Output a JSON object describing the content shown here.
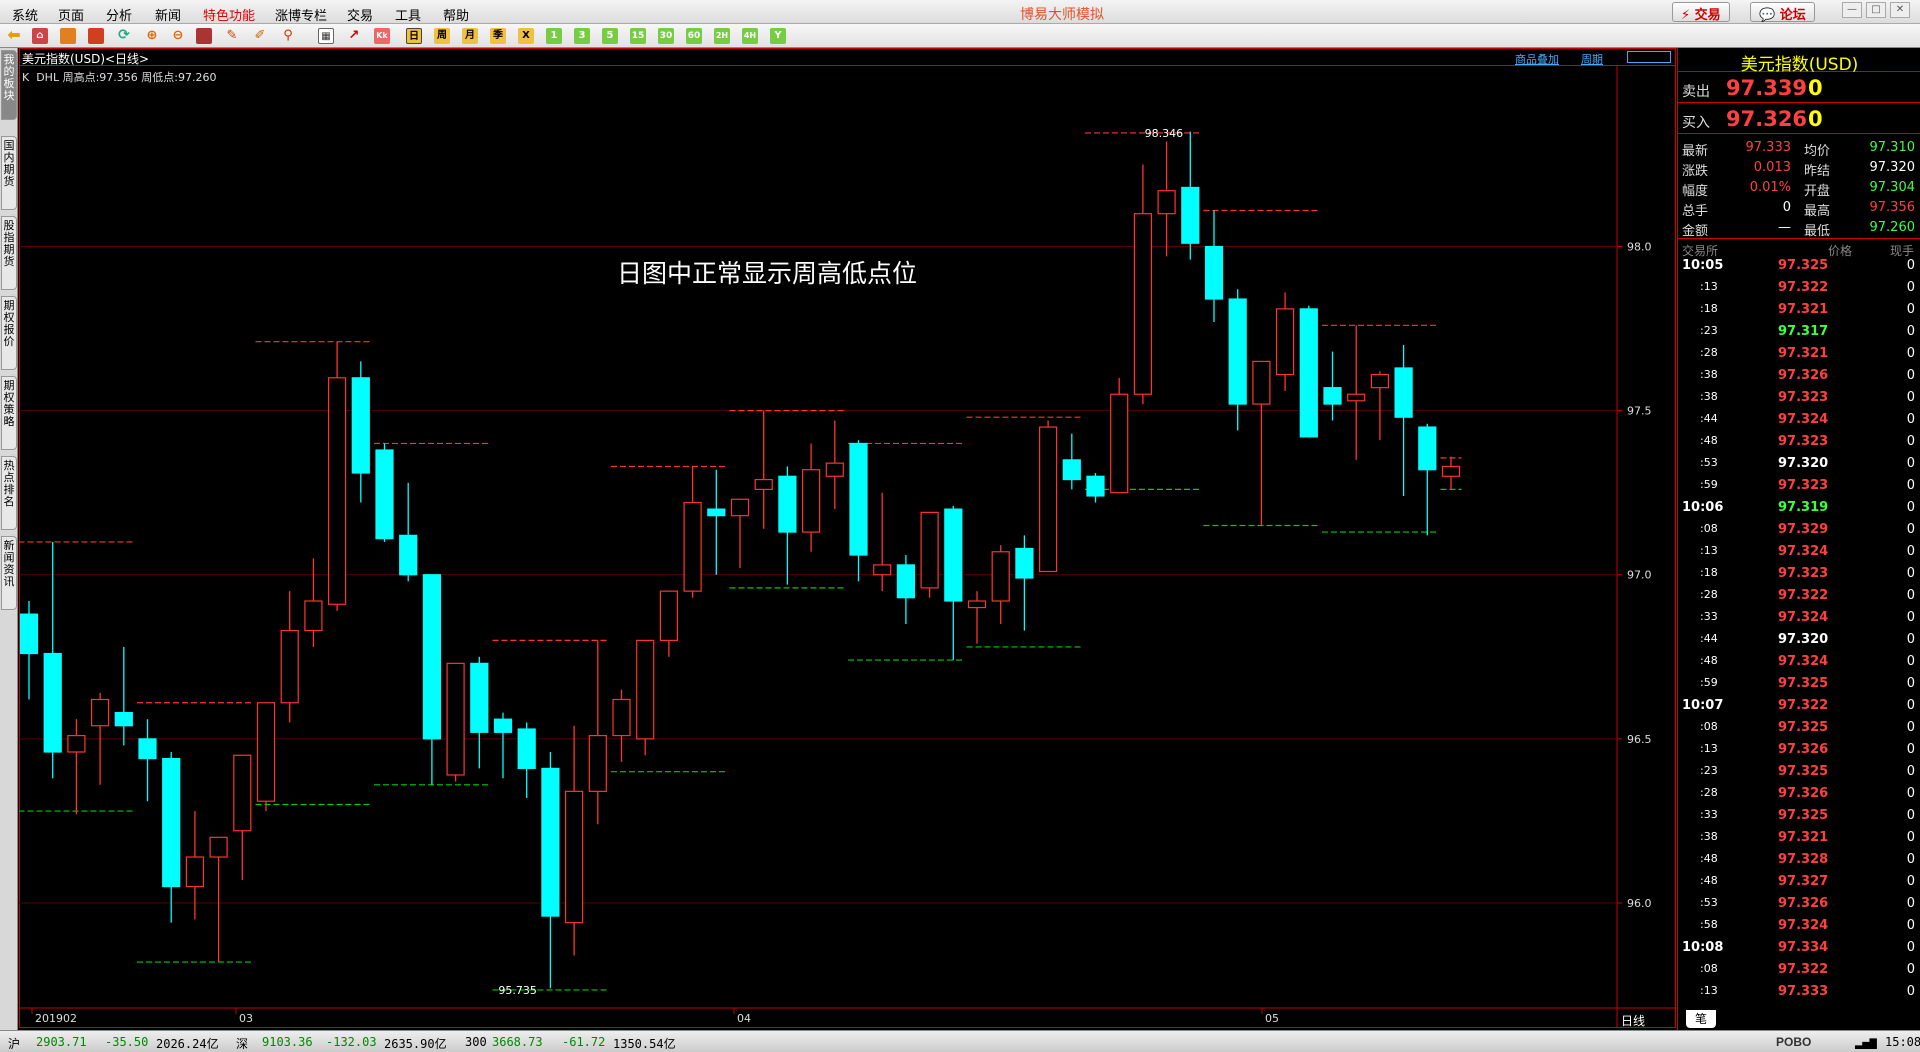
{
  "menu": {
    "items": [
      "系统",
      "页面",
      "分析",
      "新闻",
      "特色功能",
      "涨博专栏",
      "交易",
      "工具",
      "帮助"
    ],
    "title": "博易大师模拟",
    "trade_button": "交易",
    "forum_button": "论坛"
  },
  "left_tabs": [
    "我的板块",
    "国内期货",
    "股指期货",
    "期权报价",
    "期权策略",
    "热点排名",
    "新闻资讯"
  ],
  "chart": {
    "header_title": "美元指数(USD)<日线>",
    "header_links": [
      "商品叠加",
      "周期"
    ],
    "indicator_line": "K  DHL 周高点:97.356 周低点:97.260",
    "annotation": "日图中正常显示周高低点位",
    "period_label": "日线"
  },
  "chart_data": {
    "type": "candlestick",
    "title": "美元指数(USD)<日线>",
    "y_ticks": [
      "98.0",
      "97.5",
      "97.0",
      "96.5",
      "96.0"
    ],
    "x_labels": [
      "201902",
      "03",
      "04",
      "05"
    ],
    "high_marker": "98.346",
    "low_marker": "95.735",
    "candles": [
      {
        "o": 96.88,
        "h": 96.92,
        "l": 96.62,
        "c": 96.76
      },
      {
        "o": 96.76,
        "h": 97.1,
        "l": 96.38,
        "c": 96.46
      },
      {
        "o": 96.46,
        "h": 96.56,
        "l": 96.27,
        "c": 96.51
      },
      {
        "o": 96.54,
        "h": 96.64,
        "l": 96.36,
        "c": 96.62
      },
      {
        "o": 96.58,
        "h": 96.78,
        "l": 96.48,
        "c": 96.54
      },
      {
        "o": 96.5,
        "h": 96.56,
        "l": 96.31,
        "c": 96.44
      },
      {
        "o": 96.44,
        "h": 96.46,
        "l": 95.94,
        "c": 96.05
      },
      {
        "o": 96.05,
        "h": 96.28,
        "l": 95.95,
        "c": 96.14
      },
      {
        "o": 96.14,
        "h": 96.2,
        "l": 95.82,
        "c": 96.2
      },
      {
        "o": 96.22,
        "h": 96.45,
        "l": 96.07,
        "c": 96.45
      },
      {
        "o": 96.31,
        "h": 96.6,
        "l": 96.28,
        "c": 96.61
      },
      {
        "o": 96.61,
        "h": 96.95,
        "l": 96.55,
        "c": 96.83
      },
      {
        "o": 96.83,
        "h": 97.05,
        "l": 96.78,
        "c": 96.92
      },
      {
        "o": 96.91,
        "h": 97.71,
        "l": 96.89,
        "c": 97.6
      },
      {
        "o": 97.6,
        "h": 97.65,
        "l": 97.22,
        "c": 97.31
      },
      {
        "o": 97.38,
        "h": 97.4,
        "l": 97.1,
        "c": 97.11
      },
      {
        "o": 97.12,
        "h": 97.28,
        "l": 96.98,
        "c": 97
      },
      {
        "o": 97,
        "h": 97.0,
        "l": 96.36,
        "c": 96.5
      },
      {
        "o": 96.39,
        "h": 96.62,
        "l": 96.37,
        "c": 96.73
      },
      {
        "o": 96.73,
        "h": 96.75,
        "l": 96.41,
        "c": 96.52
      },
      {
        "o": 96.56,
        "h": 96.58,
        "l": 96.38,
        "c": 96.52
      },
      {
        "o": 96.53,
        "h": 96.55,
        "l": 96.32,
        "c": 96.41
      },
      {
        "o": 96.41,
        "h": 96.46,
        "l": 95.74,
        "c": 95.96
      },
      {
        "o": 95.94,
        "h": 96.54,
        "l": 95.84,
        "c": 96.34
      },
      {
        "o": 96.34,
        "h": 96.8,
        "l": 96.24,
        "c": 96.51
      },
      {
        "o": 96.51,
        "h": 96.65,
        "l": 96.43,
        "c": 96.62
      },
      {
        "o": 96.5,
        "h": 96.8,
        "l": 96.45,
        "c": 96.8
      },
      {
        "o": 96.8,
        "h": 96.95,
        "l": 96.75,
        "c": 96.95
      },
      {
        "o": 96.95,
        "h": 97.33,
        "l": 96.93,
        "c": 97.22
      },
      {
        "o": 97.2,
        "h": 97.32,
        "l": 97,
        "c": 97.18
      },
      {
        "o": 97.18,
        "h": 97.2,
        "l": 97.02,
        "c": 97.23
      },
      {
        "o": 97.26,
        "h": 97.5,
        "l": 97.14,
        "c": 97.29
      },
      {
        "o": 97.3,
        "h": 97.33,
        "l": 96.97,
        "c": 97.13
      },
      {
        "o": 97.13,
        "h": 97.4,
        "l": 97.07,
        "c": 97.32
      },
      {
        "o": 97.3,
        "h": 97.47,
        "l": 97.2,
        "c": 97.34
      },
      {
        "o": 97.4,
        "h": 97.41,
        "l": 96.98,
        "c": 97.06
      },
      {
        "o": 97.0,
        "h": 97.25,
        "l": 96.95,
        "c": 97.03
      },
      {
        "o": 97.03,
        "h": 97.06,
        "l": 96.85,
        "c": 96.93
      },
      {
        "o": 96.96,
        "h": 97.18,
        "l": 96.93,
        "c": 97.19
      },
      {
        "o": 97.2,
        "h": 97.21,
        "l": 96.74,
        "c": 96.92
      },
      {
        "o": 96.9,
        "h": 96.95,
        "l": 96.79,
        "c": 96.92
      },
      {
        "o": 96.92,
        "h": 97.09,
        "l": 96.85,
        "c": 97.07
      },
      {
        "o": 97.08,
        "h": 97.12,
        "l": 96.83,
        "c": 96.99
      },
      {
        "o": 97.01,
        "h": 97.47,
        "l": 97.03,
        "c": 97.45
      },
      {
        "o": 97.35,
        "h": 97.43,
        "l": 97.26,
        "c": 97.29
      },
      {
        "o": 97.3,
        "h": 97.31,
        "l": 97.22,
        "c": 97.24
      },
      {
        "o": 97.25,
        "h": 97.6,
        "l": 97.26,
        "c": 97.55
      },
      {
        "o": 97.55,
        "h": 98.25,
        "l": 97.52,
        "c": 98.1
      },
      {
        "o": 98.1,
        "h": 98.32,
        "l": 97.97,
        "c": 98.17
      },
      {
        "o": 98.18,
        "h": 98.35,
        "l": 97.96,
        "c": 98.01
      },
      {
        "o": 98,
        "h": 98.11,
        "l": 97.77,
        "c": 97.84
      },
      {
        "o": 97.84,
        "h": 97.87,
        "l": 97.44,
        "c": 97.52
      },
      {
        "o": 97.52,
        "h": 97.63,
        "l": 97.15,
        "c": 97.65
      },
      {
        "o": 97.61,
        "h": 97.86,
        "l": 97.56,
        "c": 97.81
      },
      {
        "o": 97.81,
        "h": 97.82,
        "l": 97.42,
        "c": 97.42
      },
      {
        "o": 97.57,
        "h": 97.68,
        "l": 97.47,
        "c": 97.52
      },
      {
        "o": 97.53,
        "h": 97.76,
        "l": 97.35,
        "c": 97.55
      },
      {
        "o": 97.57,
        "h": 97.62,
        "l": 97.41,
        "c": 97.61
      },
      {
        "o": 97.63,
        "h": 97.7,
        "l": 97.24,
        "c": 97.48
      },
      {
        "o": 97.45,
        "h": 97.46,
        "l": 97.12,
        "c": 97.32
      },
      {
        "o": 97.3,
        "h": 97.36,
        "l": 97.26,
        "c": 97.33
      }
    ],
    "weekly_levels": [
      {
        "from": 0,
        "to": 4,
        "high": 97.1,
        "low": 96.28
      },
      {
        "from": 5,
        "to": 9,
        "high": 96.61,
        "low": 95.82
      },
      {
        "from": 10,
        "to": 14,
        "high": 97.71,
        "low": 96.3
      },
      {
        "from": 15,
        "to": 19,
        "high": 97.4,
        "low": 96.36
      },
      {
        "from": 20,
        "to": 24,
        "high": 96.8,
        "low": 95.735
      },
      {
        "from": 25,
        "to": 29,
        "high": 97.33,
        "low": 96.4
      },
      {
        "from": 30,
        "to": 34,
        "high": 97.5,
        "low": 96.96
      },
      {
        "from": 35,
        "to": 39,
        "high": 97.4,
        "low": 96.74
      },
      {
        "from": 40,
        "to": 44,
        "high": 97.48,
        "low": 96.78
      },
      {
        "from": 45,
        "to": 49,
        "high": 98.346,
        "low": 97.26
      },
      {
        "from": 50,
        "to": 54,
        "high": 98.11,
        "low": 97.15
      },
      {
        "from": 55,
        "to": 59,
        "high": 97.76,
        "low": 97.13
      },
      {
        "from": 60,
        "to": 60,
        "high": 97.356,
        "low": 97.26
      }
    ],
    "ylim": [
      95.68,
      98.55
    ],
    "colors": {
      "up": "#ff3232",
      "down": "#00ffff",
      "week_high": "#ff3232",
      "week_low": "#00cc00"
    }
  },
  "quote": {
    "title": "美元指数(USD)",
    "ask_label": "卖出",
    "ask_price": "97.339",
    "ask_vol": "0",
    "bid_label": "买入",
    "bid_price": "97.326",
    "bid_vol": "0",
    "stats": [
      {
        "l1": "最新",
        "v1": "97.333",
        "c1": "red",
        "l2": "均价",
        "v2": "97.310",
        "c2": "green"
      },
      {
        "l1": "涨跌",
        "v1": "0.013",
        "c1": "red",
        "l2": "昨结",
        "v2": "97.320",
        "c2": "white"
      },
      {
        "l1": "幅度",
        "v1": "0.01%",
        "c1": "red",
        "l2": "开盘",
        "v2": "97.304",
        "c2": "green"
      },
      {
        "l1": "总手",
        "v1": "0",
        "c1": "white",
        "l2": "最高",
        "v2": "97.356",
        "c2": "red"
      },
      {
        "l1": "金额",
        "v1": "—",
        "c1": "white",
        "l2": "最低",
        "v2": "97.260",
        "c2": "green"
      }
    ],
    "ticks_header": [
      "交易所",
      "价格",
      "现手"
    ],
    "ticks": [
      {
        "t": "10:05",
        "p": "97.325",
        "c": "red",
        "v": "0",
        "bold": true
      },
      {
        "t": ":13",
        "p": "97.322",
        "c": "red",
        "v": "0"
      },
      {
        "t": ":18",
        "p": "97.321",
        "c": "red",
        "v": "0"
      },
      {
        "t": ":23",
        "p": "97.317",
        "c": "green",
        "v": "0"
      },
      {
        "t": ":28",
        "p": "97.321",
        "c": "red",
        "v": "0"
      },
      {
        "t": ":38",
        "p": "97.326",
        "c": "red",
        "v": "0"
      },
      {
        "t": ":38",
        "p": "97.323",
        "c": "red",
        "v": "0"
      },
      {
        "t": ":44",
        "p": "97.324",
        "c": "red",
        "v": "0"
      },
      {
        "t": ":48",
        "p": "97.323",
        "c": "red",
        "v": "0"
      },
      {
        "t": ":53",
        "p": "97.320",
        "c": "white",
        "v": "0"
      },
      {
        "t": ":59",
        "p": "97.323",
        "c": "red",
        "v": "0"
      },
      {
        "t": "10:06",
        "p": "97.319",
        "c": "green",
        "v": "0",
        "bold": true
      },
      {
        "t": ":08",
        "p": "97.329",
        "c": "red",
        "v": "0"
      },
      {
        "t": ":13",
        "p": "97.324",
        "c": "red",
        "v": "0"
      },
      {
        "t": ":18",
        "p": "97.323",
        "c": "red",
        "v": "0"
      },
      {
        "t": ":28",
        "p": "97.322",
        "c": "red",
        "v": "0"
      },
      {
        "t": ":33",
        "p": "97.324",
        "c": "red",
        "v": "0"
      },
      {
        "t": ":44",
        "p": "97.320",
        "c": "white",
        "v": "0"
      },
      {
        "t": ":48",
        "p": "97.324",
        "c": "red",
        "v": "0"
      },
      {
        "t": ":59",
        "p": "97.325",
        "c": "red",
        "v": "0"
      },
      {
        "t": "10:07",
        "p": "97.322",
        "c": "red",
        "v": "0",
        "bold": true
      },
      {
        "t": ":08",
        "p": "97.325",
        "c": "red",
        "v": "0"
      },
      {
        "t": ":13",
        "p": "97.326",
        "c": "red",
        "v": "0"
      },
      {
        "t": ":23",
        "p": "97.325",
        "c": "red",
        "v": "0"
      },
      {
        "t": ":28",
        "p": "97.326",
        "c": "red",
        "v": "0"
      },
      {
        "t": ":33",
        "p": "97.325",
        "c": "red",
        "v": "0"
      },
      {
        "t": ":38",
        "p": "97.321",
        "c": "red",
        "v": "0"
      },
      {
        "t": ":48",
        "p": "97.328",
        "c": "red",
        "v": "0"
      },
      {
        "t": ":48",
        "p": "97.327",
        "c": "red",
        "v": "0"
      },
      {
        "t": ":53",
        "p": "97.326",
        "c": "red",
        "v": "0"
      },
      {
        "t": ":58",
        "p": "97.324",
        "c": "red",
        "v": "0"
      },
      {
        "t": "10:08",
        "p": "97.334",
        "c": "red",
        "v": "0",
        "bold": true
      },
      {
        "t": ":08",
        "p": "97.322",
        "c": "red",
        "v": "0"
      },
      {
        "t": ":13",
        "p": "97.333",
        "c": "red",
        "v": "0"
      }
    ],
    "bottom_tab": "笔"
  },
  "status": {
    "sh_label": "沪",
    "sh_index": "2903.71",
    "sh_change": "-35.50",
    "sh_amount": "2026.24亿",
    "sz_label": "深",
    "sz_index": "9103.36",
    "sz_change": "-132.03",
    "sz_amount": "2635.90亿",
    "hs_label": "300",
    "hs_index": "3668.73",
    "hs_change": "-61.72",
    "hs_amount": "1350.54亿",
    "brand": "POBO",
    "time": "15:08"
  }
}
